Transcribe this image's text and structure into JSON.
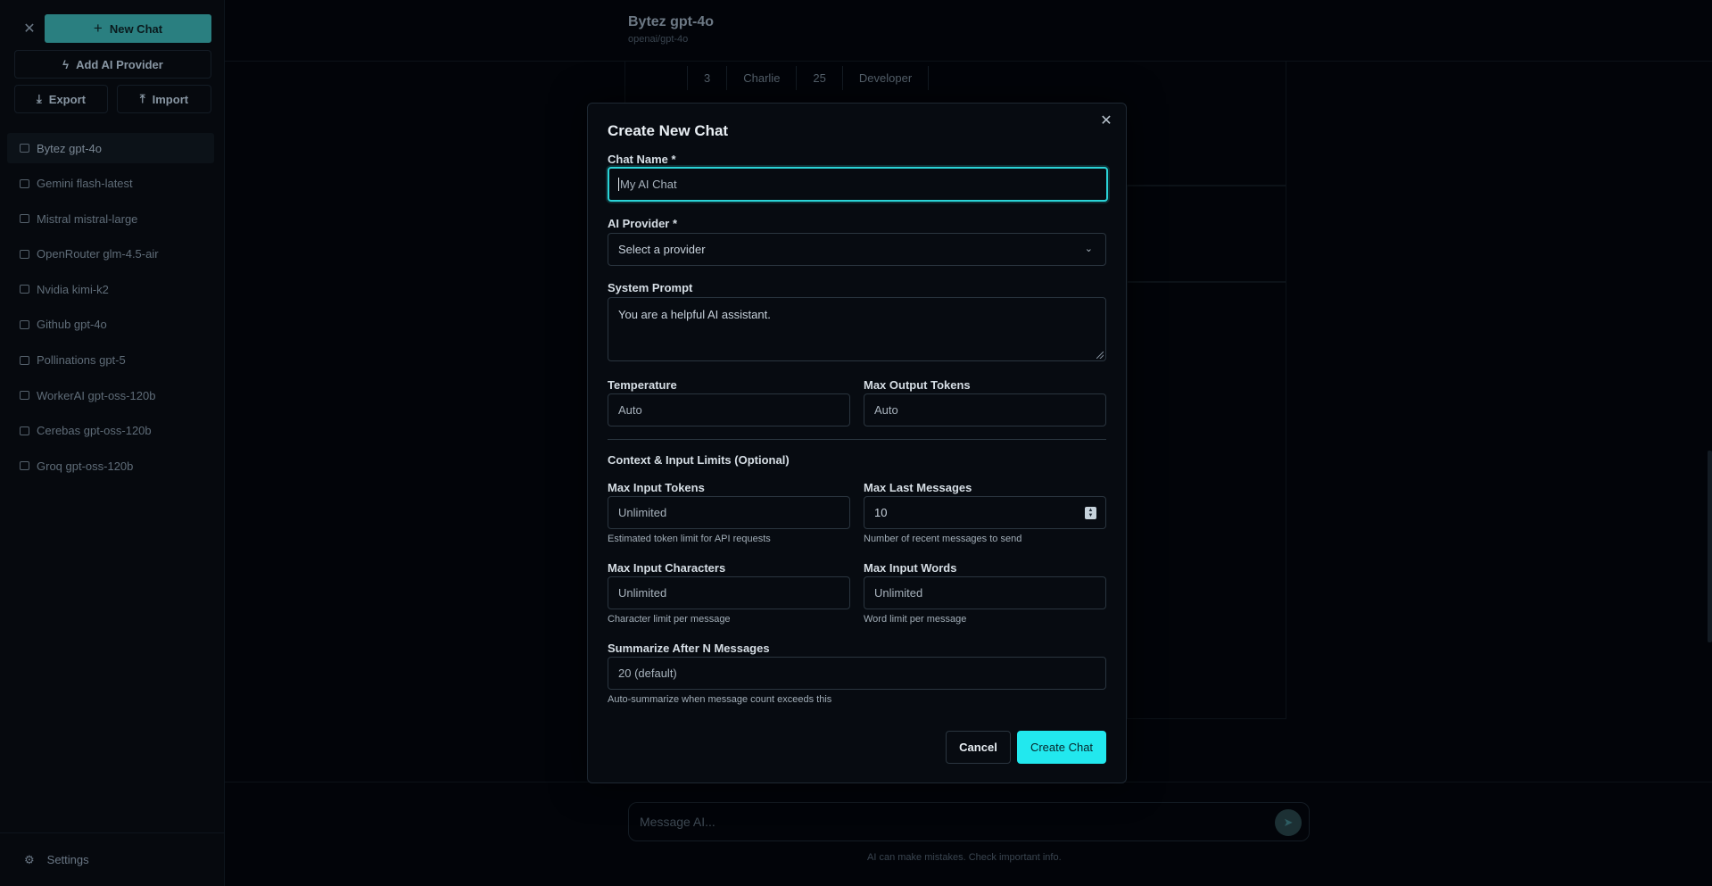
{
  "sidebar": {
    "new_chat_label": "New Chat",
    "add_provider_label": "Add AI Provider",
    "export_label": "Export",
    "import_label": "Import",
    "chats": [
      {
        "label": "Bytez gpt-4o",
        "active": true
      },
      {
        "label": "Gemini flash-latest"
      },
      {
        "label": "Mistral mistral-large"
      },
      {
        "label": "OpenRouter glm-4.5-air"
      },
      {
        "label": "Nvidia kimi-k2"
      },
      {
        "label": "Github gpt-4o"
      },
      {
        "label": "Pollinations gpt-5"
      },
      {
        "label": "WorkerAI gpt-oss-120b"
      },
      {
        "label": "Cerebas gpt-oss-120b"
      },
      {
        "label": "Groq gpt-oss-120b"
      }
    ],
    "settings_label": "Settings"
  },
  "main": {
    "title": "Bytez gpt-4o",
    "subtitle": "openai/gpt-4o",
    "table_row": [
      "3",
      "Charlie",
      "25",
      "Developer"
    ],
    "message_placeholder": "Message AI...",
    "footer_note": "AI can make mistakes. Check important info."
  },
  "modal": {
    "title": "Create New Chat",
    "chat_name": {
      "label": "Chat Name *",
      "value": "",
      "placeholder": "My AI Chat"
    },
    "provider": {
      "label": "AI Provider *",
      "selected": "Select a provider"
    },
    "system_prompt": {
      "label": "System Prompt",
      "value": "You are a helpful AI assistant."
    },
    "temperature": {
      "label": "Temperature",
      "placeholder": "Auto"
    },
    "max_output_tokens": {
      "label": "Max Output Tokens",
      "placeholder": "Auto"
    },
    "section_title": "Context & Input Limits (Optional)",
    "max_input_tokens": {
      "label": "Max Input Tokens",
      "placeholder": "Unlimited",
      "hint": "Estimated token limit for API requests"
    },
    "max_last_messages": {
      "label": "Max Last Messages",
      "value": "10",
      "hint": "Number of recent messages to send"
    },
    "max_input_characters": {
      "label": "Max Input Characters",
      "placeholder": "Unlimited",
      "hint": "Character limit per message"
    },
    "max_input_words": {
      "label": "Max Input Words",
      "placeholder": "Unlimited",
      "hint": "Word limit per message"
    },
    "summarize_after": {
      "label": "Summarize After N Messages",
      "placeholder": "20 (default)",
      "hint": "Auto-summarize when message count exceeds this"
    },
    "cancel_label": "Cancel",
    "create_label": "Create Chat"
  },
  "colors": {
    "accent": "#22e8ee",
    "focus_ring": "#2ad3d7",
    "background": "#020409",
    "modal_background": "#070b11"
  },
  "icons": {
    "close": "close-icon",
    "new_chat": "plus-icon",
    "add_provider": "lightning-icon",
    "export": "download-icon",
    "import": "upload-icon",
    "chat": "message-square-icon",
    "settings": "gear-icon",
    "send": "send-icon",
    "chevron": "chevron-down-icon"
  }
}
